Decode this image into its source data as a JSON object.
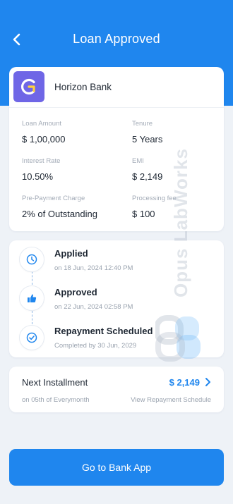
{
  "header": {
    "title": "Loan Approved",
    "back_icon": "chevron-left-icon",
    "color": "#1f86ee"
  },
  "bank": {
    "name": "Horizon Bank",
    "logo_icon": "horizon-bank-logo-icon",
    "logo_color": "#6f66e6",
    "details": [
      {
        "label": "Loan Amount",
        "value": "$ 1,00,000"
      },
      {
        "label": "Tenure",
        "value": "5 Years"
      },
      {
        "label": "Interest Rate",
        "value": "10.50%"
      },
      {
        "label": "EMI",
        "value": "$ 2,149"
      },
      {
        "label": "Pre-Payment Charge",
        "value": "2% of Outstanding"
      },
      {
        "label": "Processing fee",
        "value": "$ 100"
      }
    ]
  },
  "timeline": [
    {
      "title": "Applied",
      "subtitle": "on 18 Jun, 2024  12:40 PM",
      "icon": "clock-icon"
    },
    {
      "title": "Approved",
      "subtitle": "on 22 Jun, 2024  02:58 PM",
      "icon": "thumbs-up-icon"
    },
    {
      "title": "Repayment Scheduled",
      "subtitle": "Completed by 30 Jun, 2029",
      "icon": "check-circle-icon"
    }
  ],
  "installment": {
    "title": "Next Installment",
    "amount": "$ 2,149",
    "subtitle": "on 05th of Everymonth",
    "link": "View Repayment Schedule"
  },
  "cta": {
    "label": "Go to Bank App"
  },
  "watermark": {
    "text": "Opus LabWorks"
  },
  "colors": {
    "primary": "#1f86ee",
    "background": "#eef2f7",
    "muted_text": "#9aa3af"
  }
}
